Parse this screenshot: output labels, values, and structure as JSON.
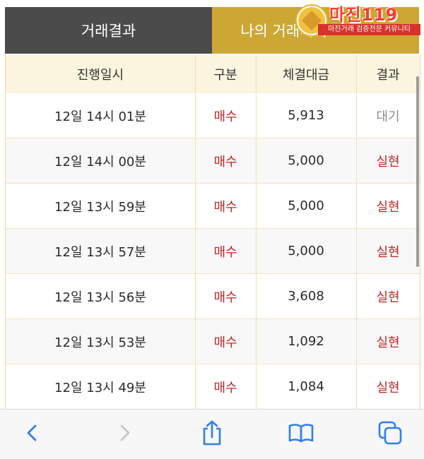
{
  "tabs": {
    "active_label": "거래결과",
    "inactive_label": "나의 거래내역"
  },
  "logo": {
    "title": "마진119",
    "subtitle": "마진거래 검증전문 커뮤니티"
  },
  "table": {
    "headers": [
      "진행일시",
      "구분",
      "체결대금",
      "결과"
    ],
    "rows": [
      {
        "time": "12일 14시 01분",
        "type": "매수",
        "amount": "5,913",
        "result": "대기"
      },
      {
        "time": "12일 14시 00분",
        "type": "매수",
        "amount": "5,000",
        "result": "실현"
      },
      {
        "time": "12일 13시 59분",
        "type": "매수",
        "amount": "5,000",
        "result": "실현"
      },
      {
        "time": "12일 13시 57분",
        "type": "매수",
        "amount": "5,000",
        "result": "실현"
      },
      {
        "time": "12일 13시 56분",
        "type": "매수",
        "amount": "3,608",
        "result": "실현"
      },
      {
        "time": "12일 13시 53분",
        "type": "매수",
        "amount": "1,092",
        "result": "실현"
      },
      {
        "time": "12일 13시 49분",
        "type": "매수",
        "amount": "1,084",
        "result": "실현"
      }
    ]
  },
  "toolbar": {
    "icons": [
      "chevron-left-icon",
      "chevron-right-icon",
      "share-icon",
      "book-icon",
      "tabs-icon"
    ]
  },
  "colors": {
    "active_tab": "#4b4b4b",
    "gold_tab": "#cda733",
    "header_bg": "#fbf4de",
    "buy_red": "#c52323",
    "wait_gray": "#8c8c8c",
    "ios_blue": "#2f7ef7"
  }
}
